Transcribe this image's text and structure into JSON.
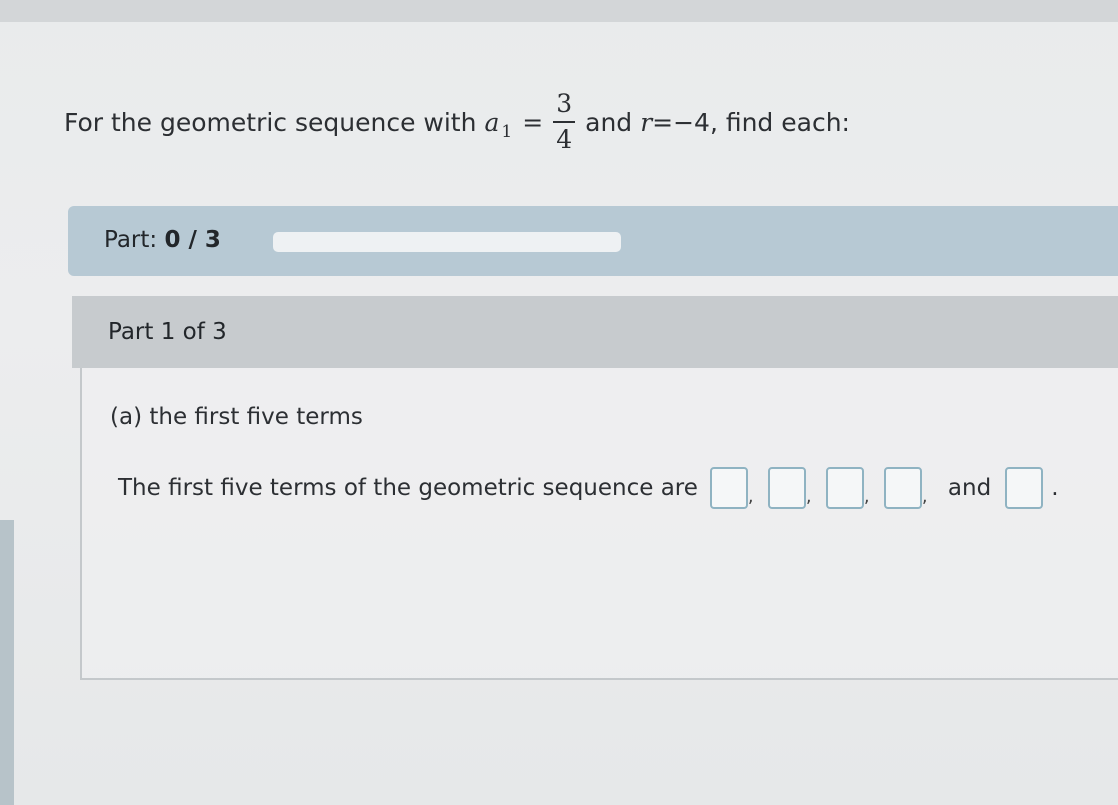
{
  "question": {
    "prefix": "For the geometric sequence with",
    "a_var": "a",
    "a_sub": "1",
    "equals": "=",
    "frac_num": "3",
    "frac_den": "4",
    "and_text": "and",
    "r_var": "r",
    "r_rest": "=−4, find each:"
  },
  "progress": {
    "label": "Part:",
    "count": "0 / 3",
    "fraction_complete": 0
  },
  "part": {
    "title": "Part 1 of 3",
    "sub_question": "(a) the first five terms",
    "answer_lead": "The first five terms of the geometric sequence are",
    "separator": ",",
    "and_text": "and",
    "end_punct": "."
  },
  "colors": {
    "progress_bar_bg": "#b7c9d4",
    "part_header_bg": "#c7cbce",
    "answer_box_border": "#8fb3c2"
  }
}
